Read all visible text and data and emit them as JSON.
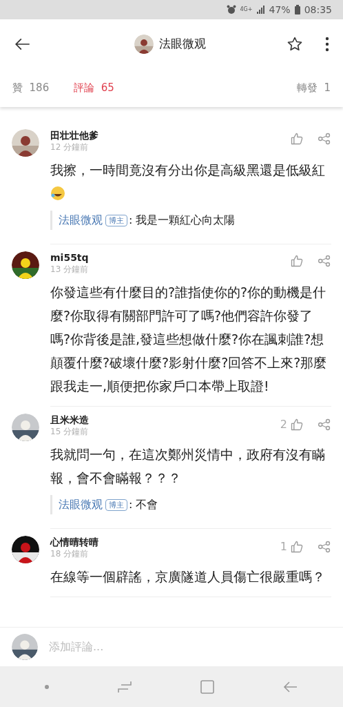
{
  "status_bar": {
    "network": "4G+",
    "battery": "47%",
    "time": "08:35"
  },
  "header": {
    "title": "法眼微观"
  },
  "tabs": [
    {
      "label": "贊",
      "count": "186",
      "selected": false
    },
    {
      "label": "評論",
      "count": "65",
      "selected": true
    },
    {
      "label": "轉發",
      "count": "1",
      "selected": false
    }
  ],
  "comments": [
    {
      "user": "田壮壮他爹",
      "time": "12 分鐘前",
      "text": "我擦，一時間竟沒有分出你是高級黑還是低級紅",
      "emoji": true,
      "reply": {
        "user": "法眼微观",
        "badge": "博主",
        "text": ": 我是一顆紅心向太陽"
      }
    },
    {
      "user": "mi55tq",
      "time": "13 分鐘前",
      "text": "你發這些有什麼目的?誰指使你的?你的動機是什麼?你取得有關部門許可了嗎?他們容許你發了嗎?你背後是誰,發這些想做什麼?你在諷刺誰?想顛覆什麼?破壞什麼?影射什麼?回答不上來?那麼跟我走一,順便把你家戶口本帶上取證!"
    },
    {
      "user": "且米米造",
      "time": "15 分鐘前",
      "likes": "2",
      "text": "我就問一句，在這次鄭州災情中，政府有沒有瞞報，會不會瞞報？？？",
      "reply": {
        "user": "法眼微观",
        "badge": "博主",
        "text": ": 不會"
      }
    },
    {
      "user": "心情晴转晴",
      "time": "18 分鐘前",
      "likes": "1",
      "text": "在線等一個辟謠，京廣隧道人員傷亡很嚴重嗎？"
    }
  ],
  "comment_input": {
    "placeholder": "添加評論..."
  }
}
